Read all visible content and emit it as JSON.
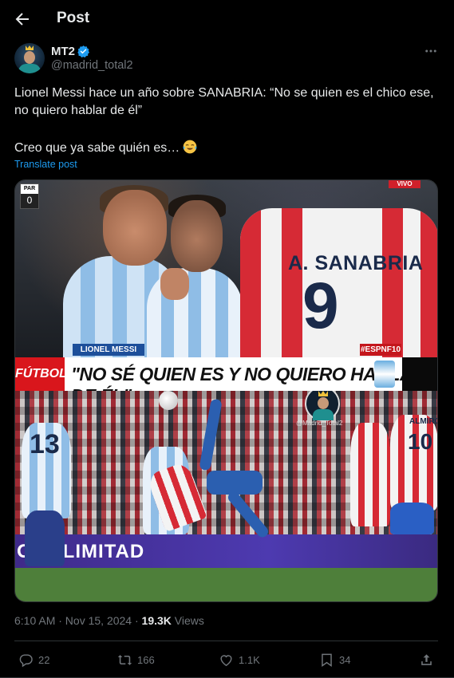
{
  "header": {
    "title": "Post"
  },
  "author": {
    "name": "MT2",
    "handle": "@madrid_total2"
  },
  "post": {
    "text_line1": "Lionel Messi hace un año sobre SANABRIA: “No se quien es el chico ese, no quiero hablar de él”",
    "text_line2": "Creo que ya sabe quién es…",
    "translate_label": "Translate post"
  },
  "media": {
    "score_label": "PAR",
    "score_value": "0",
    "live_label": "VIVO",
    "lower_third_name": "LIONEL MESSI",
    "channel_tag": "#ESPNF10",
    "jersey_name": "A. SANABRIA",
    "jersey_number": "9",
    "banner_logo": "FÚTBOL",
    "banner_quote": "\"NO SÉ QUIEN ES Y NO QUIERO HABLAR DE ÉL\"",
    "watermark": "@Madrid_Total2",
    "ad_board": "ODOLIMITAD",
    "jersey_13": "13",
    "jersey_10": "10",
    "jersey_10_name": "ALMIRÓN"
  },
  "meta": {
    "time": "6:10 AM · Nov 15, 2024 · ",
    "views_count": "19.3K",
    "views_label": " Views"
  },
  "actions": {
    "replies": "22",
    "reposts": "166",
    "likes": "1.1K",
    "bookmarks": "34"
  },
  "icons": {
    "back": "arrow-left-icon",
    "verified": "verified-badge-icon",
    "more": "more-dots-icon",
    "reply": "reply-icon",
    "repost": "repost-icon",
    "like": "heart-icon",
    "bookmark": "bookmark-icon",
    "share": "share-icon"
  },
  "colors": {
    "accent": "#1d9bf0",
    "muted": "#71767b",
    "text": "#e7e9ea",
    "background": "#000000"
  }
}
